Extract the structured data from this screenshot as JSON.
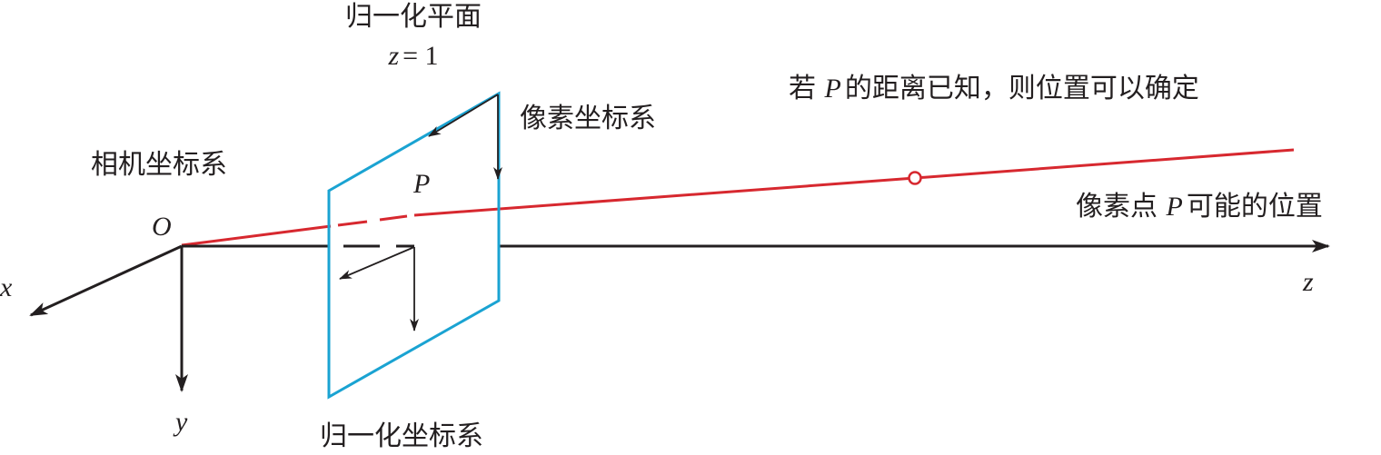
{
  "labels": {
    "plane_title": "归一化平面",
    "plane_z_var": "z",
    "plane_z_eq": "= 1",
    "note_prefix": "若 ",
    "note_var": "P",
    "note_suffix": " 的距离已知，则位置可以确定",
    "pixel_coord": "像素坐标系",
    "camera_coord": "相机坐标系",
    "point_p": "P",
    "possible_prefix": "像素点 ",
    "possible_var": "P",
    "possible_suffix": "可能的位置",
    "origin": "O",
    "axis_x": "x",
    "axis_y": "y",
    "axis_z": "z",
    "normalized_coord": "归一化坐标系"
  },
  "colors": {
    "axis": "#231f20",
    "ray": "#d7282f",
    "plane": "#1aa3d2",
    "text": "#231f20"
  },
  "icons": {
    "axis_arrowhead": "arrowhead",
    "point_marker": "hollow-circle"
  }
}
